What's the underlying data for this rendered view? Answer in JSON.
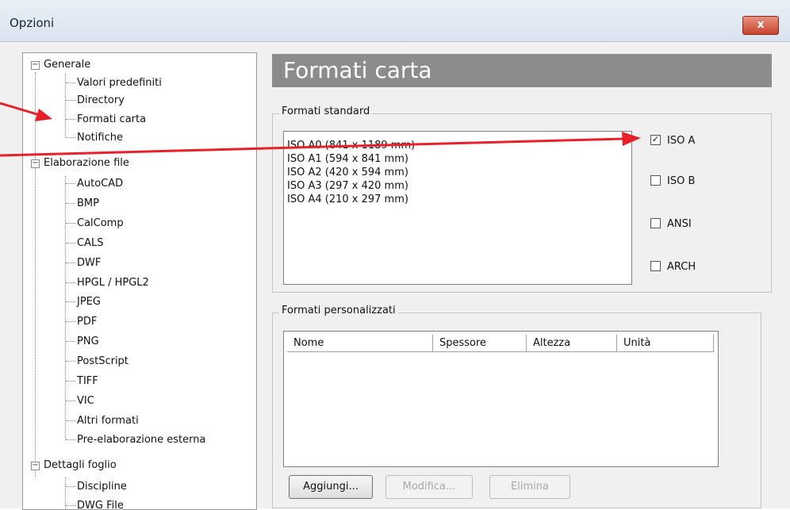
{
  "window": {
    "title": "Opzioni",
    "close_glyph": "x"
  },
  "tree": {
    "generale": "Generale",
    "generale_children": [
      "Valori predefiniti",
      "Directory",
      "Formati carta",
      "Notifiche"
    ],
    "elaborazione": "Elaborazione file",
    "elaborazione_children": [
      "AutoCAD",
      "BMP",
      "CalComp",
      "CALS",
      "DWF",
      "HPGL / HPGL2",
      "JPEG",
      "PDF",
      "PNG",
      "PostScript",
      "TIFF",
      "VIC",
      "Altri formati",
      "Pre-elaborazione esterna"
    ],
    "dettagli": "Dettagli foglio",
    "dettagli_children": [
      "Discipline",
      "DWG File"
    ]
  },
  "page": {
    "header": "Formati carta"
  },
  "standard": {
    "label": "Formati standard",
    "items": [
      "ISO A0 (841 x 1189 mm)",
      "ISO A1 (594 x 841 mm)",
      "ISO A2 (420 x 594 mm)",
      "ISO A3 (297 x 420 mm)",
      "ISO A4 (210  x 297 mm)"
    ],
    "checks": [
      {
        "label": "ISO A",
        "checked": true
      },
      {
        "label": "ISO B",
        "checked": false
      },
      {
        "label": "ANSI",
        "checked": false
      },
      {
        "label": "ARCH",
        "checked": false
      }
    ]
  },
  "custom": {
    "label": "Formati personalizzati",
    "columns": [
      "Nome",
      "Spessore",
      "Altezza",
      "Unità"
    ]
  },
  "buttons": {
    "add": "Aggiungi...",
    "edit": "Modifica...",
    "delete": "Elimina"
  },
  "colors": {
    "annotation_arrow": "#e8202a",
    "header_bar": "#8c8c8c"
  }
}
